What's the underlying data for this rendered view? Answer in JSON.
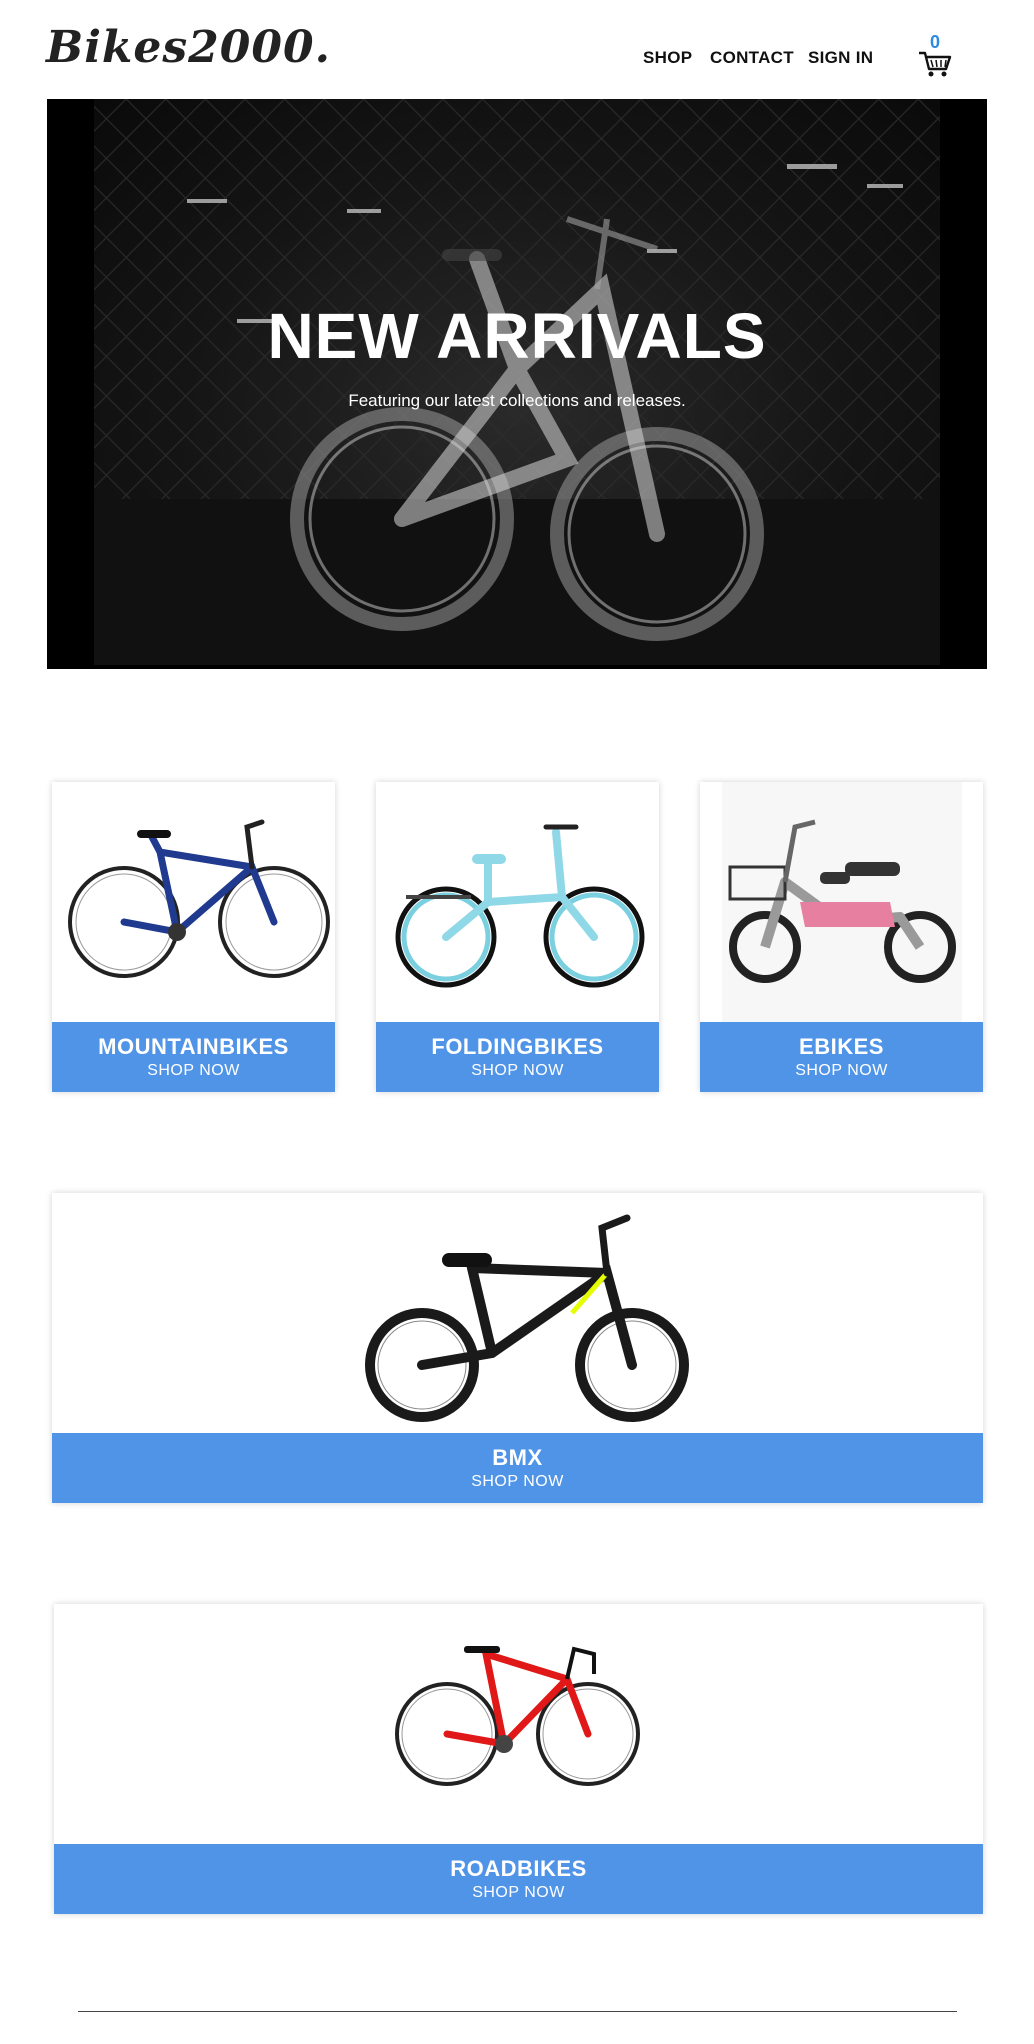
{
  "header": {
    "logo": "Bikes2000.",
    "nav": {
      "shop": "SHOP",
      "contact": "CONTACT",
      "signin": "SIGN IN"
    },
    "cart_count": "0"
  },
  "hero": {
    "title": "NEW ARRIVALS",
    "subtitle": "Featuring our latest collections and releases."
  },
  "categories": [
    {
      "title": "MOUNTAINBIKES",
      "cta": "SHOP NOW",
      "frame_color": "#1f3a8f"
    },
    {
      "title": "FOLDINGBIKES",
      "cta": "SHOP NOW",
      "frame_color": "#8fd8e8"
    },
    {
      "title": "EBIKES",
      "cta": "SHOP NOW",
      "frame_color": "#e67fa0"
    },
    {
      "title": "BMX",
      "cta": "SHOP NOW",
      "frame_color": "#1a1a1a"
    },
    {
      "title": "ROADBIKES",
      "cta": "SHOP NOW",
      "frame_color": "#e01818"
    }
  ],
  "colors": {
    "accent": "#5094e8",
    "cart_badge": "#2b8be0"
  }
}
